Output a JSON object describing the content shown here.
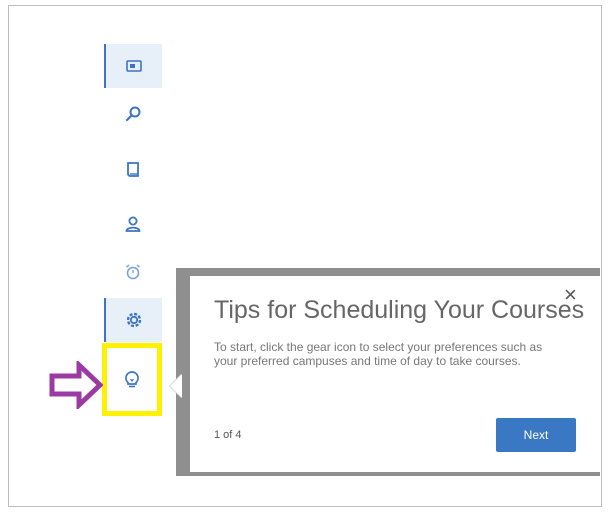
{
  "sidebar": {
    "items": [
      {
        "icon": "id-card-icon",
        "active": true
      },
      {
        "icon": "search-icon",
        "active": false
      },
      {
        "icon": "book-icon",
        "active": false
      },
      {
        "icon": "user-icon",
        "active": false
      },
      {
        "icon": "alarm-clock-icon",
        "active": false
      },
      {
        "icon": "gear-icon",
        "active": true
      },
      {
        "icon": "lightbulb-icon",
        "active": false
      }
    ]
  },
  "annotation": {
    "arrow_color": "#9b3aa3",
    "highlight_color": "#fff200"
  },
  "tip": {
    "title": "Tips for Scheduling Your Courses",
    "close_label": "×",
    "body": "To start, click the gear icon to select your preferences such as your preferred campuses and time of day to take courses.",
    "step": "1 of 4",
    "next_label": "Next"
  },
  "colors": {
    "accent": "#3a78c3",
    "active_bg": "#e7eff9",
    "icon": "#3d74c4"
  }
}
